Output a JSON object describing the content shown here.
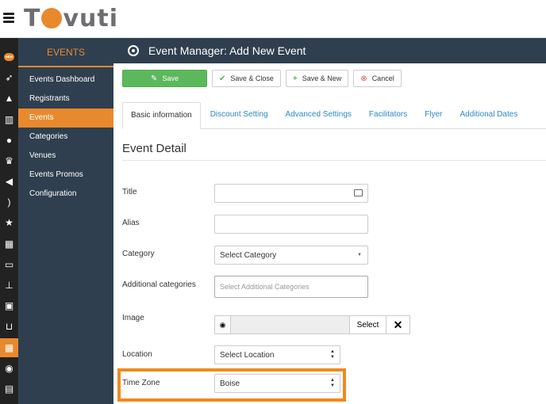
{
  "brand": {
    "logo_text_before": "T",
    "logo_text_after": "vuti"
  },
  "rail": {
    "icons": [
      "new-badge-icon",
      "rocket-icon",
      "graduation-cap-icon",
      "bar-chart-icon",
      "users-icon",
      "trophy-icon",
      "megaphone-icon",
      "feed-icon",
      "star-icon",
      "table-icon",
      "credit-card-icon",
      "sitemap-icon",
      "id-card-icon",
      "cart-icon",
      "calendar-icon",
      "chat-icon",
      "document-icon"
    ],
    "new_badge": "NEW"
  },
  "sidebar": {
    "header": "EVENTS",
    "items": [
      {
        "label": "Events Dashboard"
      },
      {
        "label": "Registrants"
      },
      {
        "label": "Events"
      },
      {
        "label": "Categories"
      },
      {
        "label": "Venues"
      },
      {
        "label": "Events Promos"
      },
      {
        "label": "Configuration"
      }
    ],
    "active_index": 2
  },
  "header": {
    "title": "Event Manager: Add New Event"
  },
  "toolbar": {
    "save_label": "Save",
    "save_close_label": "Save & Close",
    "save_new_label": "Save & New",
    "cancel_label": "Cancel"
  },
  "tabs": [
    {
      "label": "Basic information"
    },
    {
      "label": "Discount Setting"
    },
    {
      "label": "Advanced Settings"
    },
    {
      "label": "Facilitators"
    },
    {
      "label": "Flyer"
    },
    {
      "label": "Additional Dates"
    }
  ],
  "form": {
    "section_title": "Event Detail",
    "title_label": "Title",
    "title_value": "",
    "alias_label": "Alias",
    "alias_value": "",
    "category_label": "Category",
    "category_value": "Select Category",
    "additional_categories_label": "Additional categories",
    "additional_categories_placeholder": "Select Additional Categories",
    "image_label": "Image",
    "image_select_label": "Select",
    "location_label": "Location",
    "location_value": "Select Location",
    "timezone_label": "Time Zone",
    "timezone_value": "Boise"
  },
  "colors": {
    "accent": "#e8892e",
    "sidebar_bg": "#2f3f4f",
    "save_green": "#5cb85c",
    "link_blue": "#2a8ac3",
    "highlight": "#f0891f"
  }
}
